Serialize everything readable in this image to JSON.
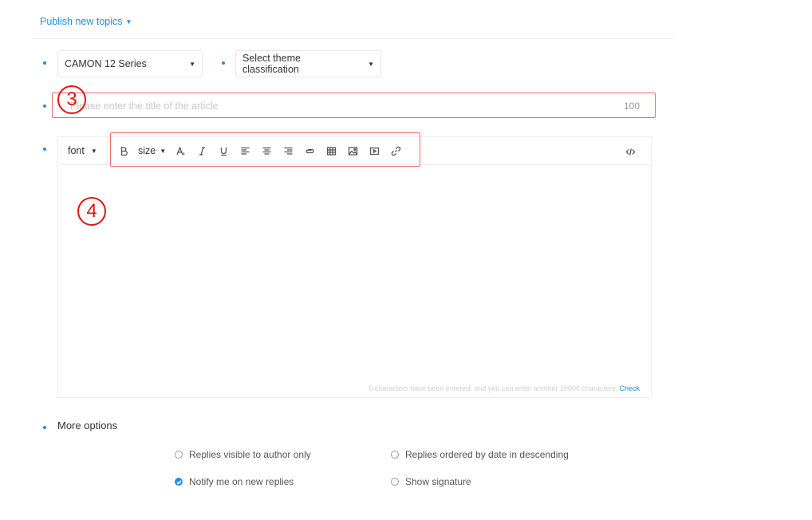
{
  "header": {
    "title": "Publish new topics",
    "caret_icon": "caret-down-icon"
  },
  "selects": {
    "series": {
      "value": "CAMON 12 Series"
    },
    "theme": {
      "value": "Select theme classification"
    }
  },
  "title_input": {
    "placeholder": "Please enter the title of the article",
    "counter": "100"
  },
  "annotations": {
    "title_marker": "3",
    "editor_marker": "4",
    "marker_color": "#e01414"
  },
  "editor": {
    "font_label": "font",
    "size_label": "size",
    "footer_text": "0 characters have been entered, and you can enter another 10000 characters.",
    "footer_link": "Check"
  },
  "toolbar_icons": [
    "bold-icon",
    "font-color-icon",
    "italic-icon",
    "underline-icon",
    "align-left-icon",
    "align-center-icon",
    "align-right-icon",
    "attachment-icon",
    "table-icon",
    "image-icon",
    "video-icon",
    "link-icon",
    "code-view-icon"
  ],
  "more_options": {
    "label": "More options",
    "items": [
      {
        "label": "Replies visible to author only",
        "checked": false
      },
      {
        "label": "Replies ordered by date in descending",
        "checked": false
      },
      {
        "label": "Notify me on new replies",
        "checked": true
      },
      {
        "label": "Show signature",
        "checked": false
      }
    ]
  },
  "colors": {
    "accent": "#1e8fe0",
    "annotation_border": "#ee6b6b",
    "border": "#e6e6e6"
  }
}
